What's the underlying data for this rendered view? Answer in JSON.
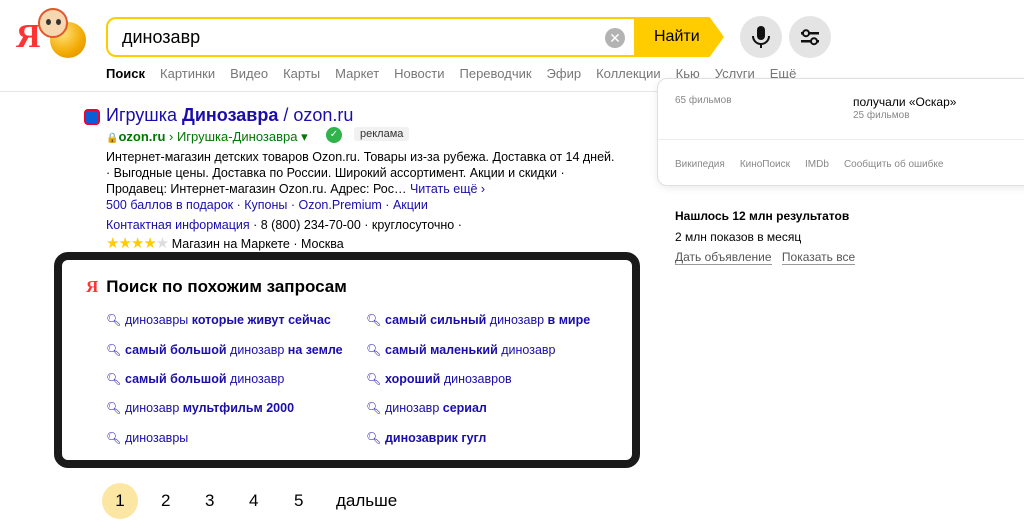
{
  "header": {
    "search_value": "динозавр",
    "find_label": "Найти",
    "logo_letter": "Я"
  },
  "tabs": [
    {
      "label": "Поиск",
      "active": true
    },
    {
      "label": "Картинки"
    },
    {
      "label": "Видео"
    },
    {
      "label": "Карты"
    },
    {
      "label": "Маркет"
    },
    {
      "label": "Новости"
    },
    {
      "label": "Переводчик"
    },
    {
      "label": "Эфир"
    },
    {
      "label": "Коллекции"
    },
    {
      "label": "Кью"
    },
    {
      "label": "Услуги"
    },
    {
      "label": "Ещё"
    }
  ],
  "knowledge_card": {
    "films_count": "65 фильмов",
    "oscar_text": "получали «Оскар»",
    "films_count_2": "25 фильмов",
    "sources": [
      "Википедия",
      "КиноПоиск",
      "IMDb",
      "Сообщить об ошибке"
    ]
  },
  "ad_stats": {
    "results": "Нашлось 12 млн результатов",
    "impressions": "2 млн показов в месяц",
    "link_ad": "Дать объявление",
    "link_all": "Показать все"
  },
  "ad_result": {
    "title_prefix": "Игрушка ",
    "title_bold": "Динозавра",
    "title_suffix": " / ozon.ru",
    "url_domain": "ozon.ru",
    "url_path": " › Игрушка-Динозавра ▾",
    "ad_label": "реклама",
    "snippet_1": "Интернет-магазин детских товаров Ozon.ru. Товары из-за рубежа. Доставка от 14 дней. · Выгодные цены. Доставка по России. Широкий ассортимент. Акции и скидки · Продавец: Интернет-магазин Ozon.ru. Адрес: Рос…",
    "read_more": "Читать ещё ›",
    "sitelinks": "500 баллов в подарок · Купоны · Ozon.Premium · Акции",
    "contacts_link": "Контактная информация",
    "contacts_rest": " · 8 (800) 234-70-00 · круглосуточно ·",
    "rating_text": " Магазин на Маркете · Москва",
    "rating_value": 4,
    "rating_max": 5
  },
  "related": {
    "title": "Поиск по похожим запросам",
    "left": [
      {
        "normal": "динозавры ",
        "bold": "которые живут сейчас",
        "tail": ""
      },
      {
        "normal": "",
        "bold": "самый большой",
        "tail": " динозавр ",
        "bold2": "на земле"
      },
      {
        "normal": "",
        "bold": "самый большой",
        "tail": " динозавр"
      },
      {
        "normal": "динозавр ",
        "bold": "мультфильм 2000",
        "tail": ""
      },
      {
        "normal": "динозавры",
        "bold": "",
        "tail": ""
      }
    ],
    "right": [
      {
        "normal": "",
        "bold": "самый сильный",
        "tail": " динозавр ",
        "bold2": "в мире"
      },
      {
        "normal": "",
        "bold": "самый маленький",
        "tail": " динозавр"
      },
      {
        "normal": "",
        "bold": "хороший",
        "tail": " динозавров"
      },
      {
        "normal": "динозавр ",
        "bold": "сериал",
        "tail": ""
      },
      {
        "normal": "",
        "bold": "динозаврик гугл",
        "tail": ""
      }
    ]
  },
  "pagination": {
    "pages": [
      "1",
      "2",
      "3",
      "4",
      "5"
    ],
    "current": "1",
    "next_label": "дальше"
  },
  "colors": {
    "accent": "#ffcc00",
    "link": "#1a0dab",
    "url_green": "#007700"
  }
}
